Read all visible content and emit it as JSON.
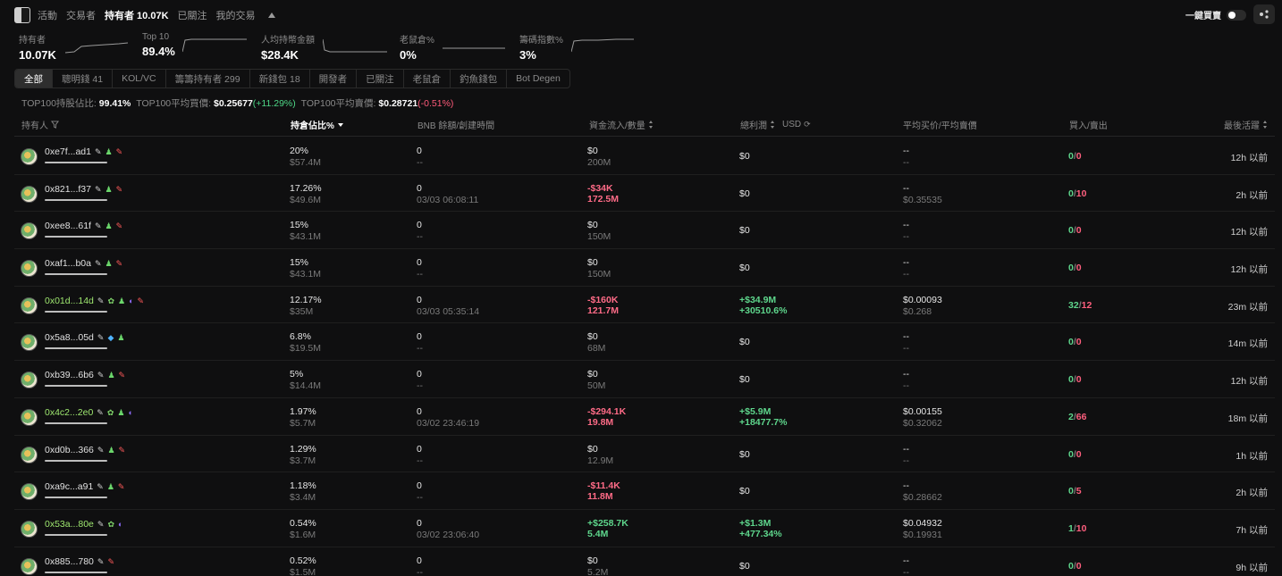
{
  "topbar": {
    "tabs": [
      "活動",
      "交易者",
      "持有者 10.07K",
      "已關注",
      "我的交易"
    ],
    "active_tab": 2,
    "quick_trade_label": "一鍵買賣"
  },
  "stats": [
    {
      "label": "持有者",
      "value": "10.07K"
    },
    {
      "label": "Top 10",
      "value": "89.4%"
    },
    {
      "label": "人均持幣金額",
      "value": "$28.4K"
    },
    {
      "label": "老鼠倉%",
      "value": "0%"
    },
    {
      "label": "籌碼指數%",
      "value": "3%"
    }
  ],
  "filters": [
    "全部",
    "聰明錢 41",
    "KOL/VC",
    "籌籌持有者 299",
    "新錢包 18",
    "開發者",
    "已關注",
    "老鼠倉",
    "釣魚錢包",
    "Bot Degen"
  ],
  "summary": {
    "top100_label": "TOP100持股佔比:",
    "top100_value": "99.41%",
    "avg_buy_label": "TOP100平均買價:",
    "avg_buy_value": "$0.25677",
    "avg_buy_change": "(+11.29%)",
    "avg_sell_label": "TOP100平均賣價:",
    "avg_sell_value": "$0.28721",
    "avg_sell_change": "(-0.51%)"
  },
  "columns": {
    "holder": "持有人",
    "share": "持倉佔比%",
    "bnb": "BNB 餘額/創建時間",
    "flow": "資金流入/數量",
    "profit": "總利潤",
    "currency": "USD",
    "price": "平均买价/平均賣價",
    "buysell": "買入/賣出",
    "last": "最後活躍"
  },
  "rows": [
    {
      "addr": "0xe7f...ad1",
      "tags": [
        "edit",
        "person",
        "pill"
      ],
      "share": "20%",
      "share_usd": "$57.4M",
      "bnb": "0",
      "created": "--",
      "flow": "$0",
      "flow_qty": "200M",
      "flow_type": "n",
      "profit": "$0",
      "profit_pct": "",
      "avg_buy": "--",
      "avg_sell": "--",
      "buys": "0",
      "sells": "0",
      "last": "12h 以前"
    },
    {
      "addr": "0x821...f37",
      "tags": [
        "edit",
        "person",
        "pill"
      ],
      "share": "17.26%",
      "share_usd": "$49.6M",
      "bnb": "0",
      "created": "03/03 06:08:11",
      "flow": "-$34K",
      "flow_qty": "172.5M",
      "flow_type": "r",
      "profit": "$0",
      "profit_pct": "",
      "avg_buy": "--",
      "avg_sell": "$0.35535",
      "buys": "0",
      "sells": "10",
      "last": "2h 以前"
    },
    {
      "addr": "0xee8...61f",
      "tags": [
        "edit",
        "person",
        "pill"
      ],
      "share": "15%",
      "share_usd": "$43.1M",
      "bnb": "0",
      "created": "--",
      "flow": "$0",
      "flow_qty": "150M",
      "flow_type": "n",
      "profit": "$0",
      "profit_pct": "",
      "avg_buy": "--",
      "avg_sell": "--",
      "buys": "0",
      "sells": "0",
      "last": "12h 以前"
    },
    {
      "addr": "0xaf1...b0a",
      "tags": [
        "edit",
        "person",
        "pill"
      ],
      "share": "15%",
      "share_usd": "$43.1M",
      "bnb": "0",
      "created": "--",
      "flow": "$0",
      "flow_qty": "150M",
      "flow_type": "n",
      "profit": "$0",
      "profit_pct": "",
      "avg_buy": "--",
      "avg_sell": "--",
      "buys": "0",
      "sells": "0",
      "last": "12h 以前"
    },
    {
      "addr": "0x01d...14d",
      "green": true,
      "tags": [
        "edit",
        "leaf",
        "person",
        "moon",
        "pill"
      ],
      "share": "12.17%",
      "share_usd": "$35M",
      "bnb": "0",
      "created": "03/03 05:35:14",
      "flow": "-$160K",
      "flow_qty": "121.7M",
      "flow_type": "r",
      "profit": "+$34.9M",
      "profit_pct": "+30510.6%",
      "avg_buy": "$0.00093",
      "avg_sell": "$0.268",
      "buys": "32",
      "sells": "12",
      "last": "23m 以前"
    },
    {
      "addr": "0x5a8...05d",
      "tags": [
        "edit",
        "drop",
        "person"
      ],
      "share": "6.8%",
      "share_usd": "$19.5M",
      "bnb": "0",
      "created": "--",
      "flow": "$0",
      "flow_qty": "68M",
      "flow_type": "n",
      "profit": "$0",
      "profit_pct": "",
      "avg_buy": "--",
      "avg_sell": "--",
      "buys": "0",
      "sells": "0",
      "last": "14m 以前"
    },
    {
      "addr": "0xb39...6b6",
      "tags": [
        "edit",
        "person",
        "pill"
      ],
      "share": "5%",
      "share_usd": "$14.4M",
      "bnb": "0",
      "created": "--",
      "flow": "$0",
      "flow_qty": "50M",
      "flow_type": "n",
      "profit": "$0",
      "profit_pct": "",
      "avg_buy": "--",
      "avg_sell": "--",
      "buys": "0",
      "sells": "0",
      "last": "12h 以前"
    },
    {
      "addr": "0x4c2...2e0",
      "green": true,
      "tags": [
        "edit",
        "leaf",
        "person",
        "moon"
      ],
      "share": "1.97%",
      "share_usd": "$5.7M",
      "bnb": "0",
      "created": "03/02 23:46:19",
      "flow": "-$294.1K",
      "flow_qty": "19.8M",
      "flow_type": "r",
      "profit": "+$5.9M",
      "profit_pct": "+18477.7%",
      "avg_buy": "$0.00155",
      "avg_sell": "$0.32062",
      "buys": "2",
      "sells": "66",
      "last": "18m 以前"
    },
    {
      "addr": "0xd0b...366",
      "tags": [
        "edit",
        "person",
        "pill"
      ],
      "share": "1.29%",
      "share_usd": "$3.7M",
      "bnb": "0",
      "created": "--",
      "flow": "$0",
      "flow_qty": "12.9M",
      "flow_type": "n",
      "profit": "$0",
      "profit_pct": "",
      "avg_buy": "--",
      "avg_sell": "--",
      "buys": "0",
      "sells": "0",
      "last": "1h 以前"
    },
    {
      "addr": "0xa9c...a91",
      "tags": [
        "edit",
        "person",
        "pill"
      ],
      "share": "1.18%",
      "share_usd": "$3.4M",
      "bnb": "0",
      "created": "--",
      "flow": "-$11.4K",
      "flow_qty": "11.8M",
      "flow_type": "r",
      "profit": "$0",
      "profit_pct": "",
      "avg_buy": "--",
      "avg_sell": "$0.28662",
      "buys": "0",
      "sells": "5",
      "last": "2h 以前"
    },
    {
      "addr": "0x53a...80e",
      "green": true,
      "tags": [
        "edit",
        "leaf",
        "moon"
      ],
      "share": "0.54%",
      "share_usd": "$1.6M",
      "bnb": "0",
      "created": "03/02 23:06:40",
      "flow": "+$258.7K",
      "flow_qty": "5.4M",
      "flow_type": "g",
      "profit": "+$1.3M",
      "profit_pct": "+477.34%",
      "avg_buy": "$0.04932",
      "avg_sell": "$0.19931",
      "buys": "1",
      "sells": "10",
      "last": "7h 以前"
    },
    {
      "addr": "0x885...780",
      "tags": [
        "edit",
        "pill"
      ],
      "share": "0.52%",
      "share_usd": "$1.5M",
      "bnb": "0",
      "created": "--",
      "flow": "$0",
      "flow_qty": "5.2M",
      "flow_type": "n",
      "profit": "$0",
      "profit_pct": "",
      "avg_buy": "--",
      "avg_sell": "--",
      "buys": "0",
      "sells": "0",
      "last": "9h 以前"
    }
  ],
  "icons": {
    "edit": "✎",
    "person": "♟",
    "pill": "✎",
    "leaf": "✿",
    "moon": "◐",
    "drop": "◆"
  },
  "colors": {
    "green": "#5ed68c",
    "red": "#ff5f7e",
    "background": "#0f0f10"
  }
}
